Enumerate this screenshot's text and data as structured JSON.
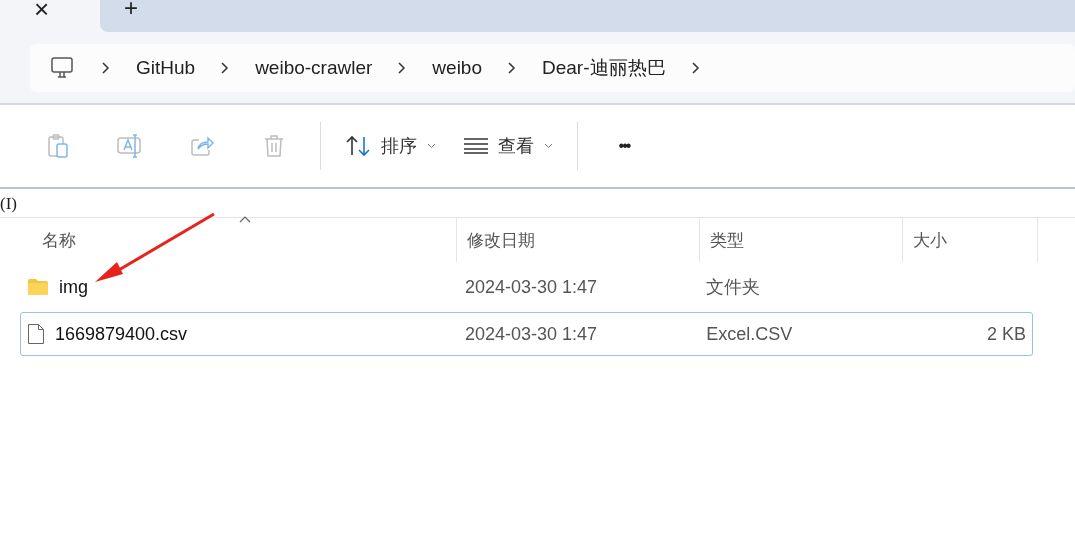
{
  "tabs": {
    "close_glyph": "×",
    "new_glyph": "+"
  },
  "breadcrumb": [
    "GitHub",
    "weibo-crawler",
    "weibo",
    "Dear-迪丽热巴"
  ],
  "toolbar": {
    "disabled_actions": [
      {
        "kind": "copy",
        "disabled": true
      },
      {
        "kind": "rename",
        "disabled": true
      },
      {
        "kind": "share",
        "disabled": true
      },
      {
        "kind": "delete",
        "disabled": true
      }
    ],
    "sort_label": "排序",
    "view_label": "查看",
    "more_glyph": "•••"
  },
  "stray_text": "(I)",
  "columns": [
    "名称",
    "修改日期",
    "类型",
    "大小"
  ],
  "files": [
    {
      "kind": "folder",
      "name": "img",
      "modified": "2024-03-30 1:47",
      "type": "文件夹",
      "selected": false
    },
    {
      "kind": "file",
      "name": "1669879400.csv",
      "modified": "2024-03-30 1:47",
      "type": "Excel.CSV",
      "size": "2 KB",
      "selected": true
    }
  ]
}
